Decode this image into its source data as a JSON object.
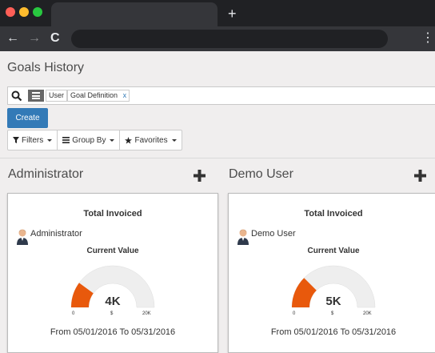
{
  "browser": {
    "new_tab_symbol": "+",
    "back_symbol": "←",
    "forward_symbol": "→",
    "reload_symbol": "C",
    "menu_symbol": "⋮"
  },
  "page": {
    "title": "Goals History"
  },
  "search": {
    "facet_values": [
      "User",
      "Goal Definition"
    ],
    "remove_symbol": "x"
  },
  "toolbar": {
    "create_label": "Create",
    "filters_label": "Filters",
    "groupby_label": "Group By",
    "favorites_label": "Favorites"
  },
  "columns": [
    {
      "header": "Administrator",
      "card": {
        "title": "Total Invoiced",
        "user": "Administrator",
        "current_value_label": "Current Value",
        "value": "4K",
        "min": "0",
        "currency": "$",
        "max": "20K",
        "gauge_fraction": 0.2,
        "period": "From 05/01/2016 To 05/31/2016"
      }
    },
    {
      "header": "Demo User",
      "card": {
        "title": "Total Invoiced",
        "user": "Demo User",
        "current_value_label": "Current Value",
        "value": "5K",
        "min": "0",
        "currency": "$",
        "max": "20K",
        "gauge_fraction": 0.25,
        "period": "From 05/01/2016 To 05/31/2016"
      }
    }
  ],
  "colors": {
    "accent": "#337ab7",
    "gauge_fill": "#e8590c",
    "gauge_track": "#eeeeee"
  }
}
